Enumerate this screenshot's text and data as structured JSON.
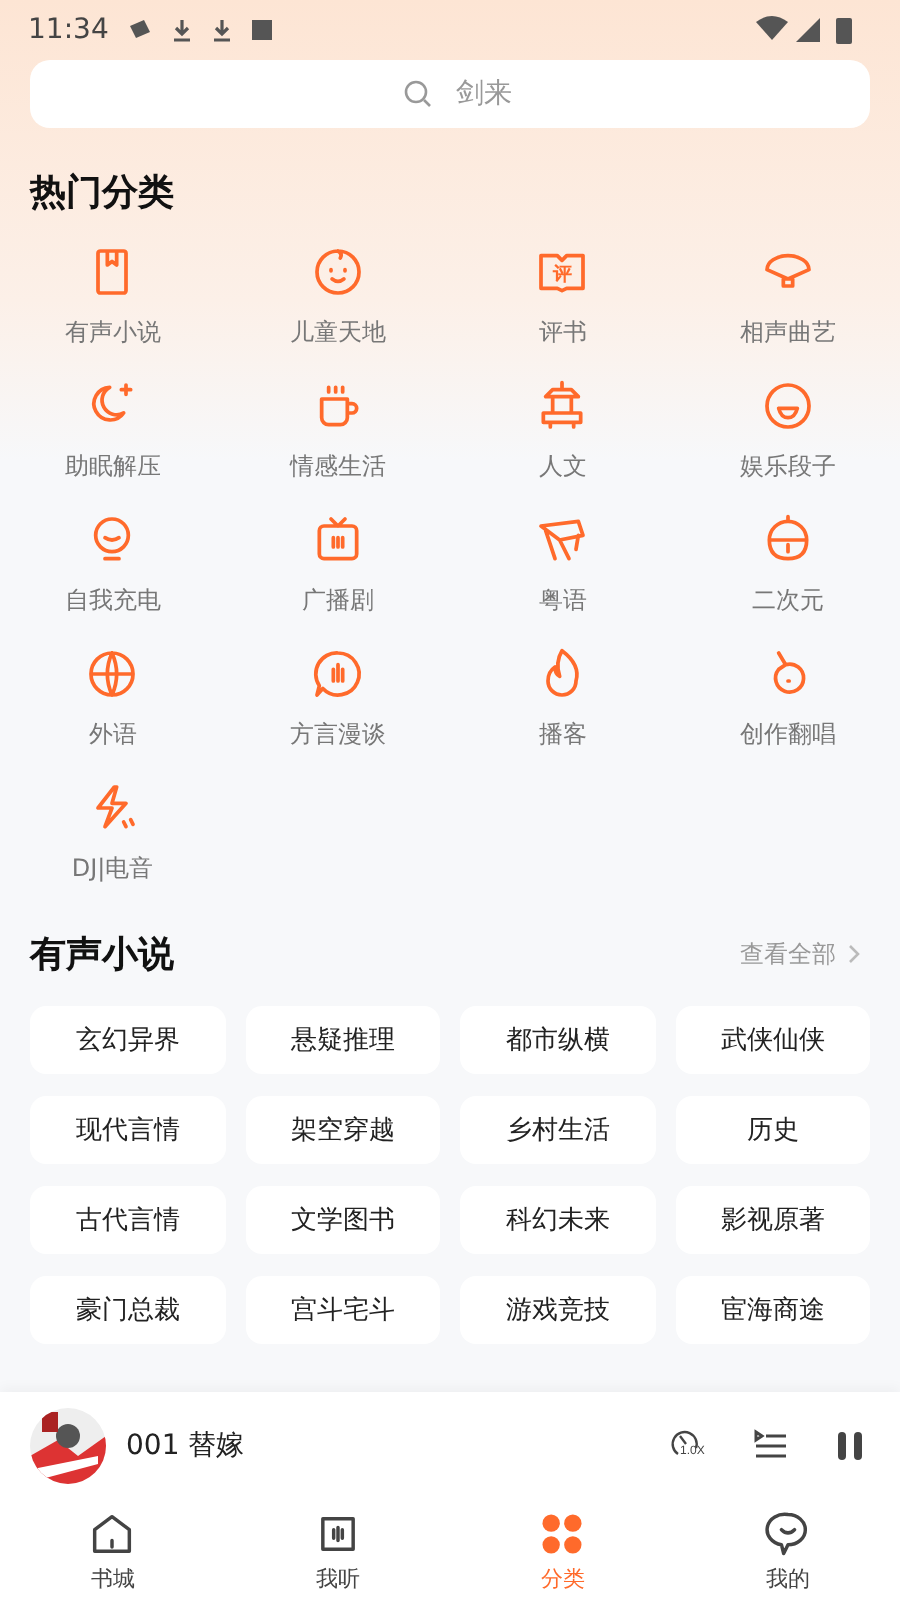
{
  "status_bar": {
    "time": "11:34"
  },
  "search": {
    "placeholder": "剑来"
  },
  "hot_categories": {
    "title": "热门分类",
    "items": [
      {
        "label": "有声小说"
      },
      {
        "label": "儿童天地"
      },
      {
        "label": "评书",
        "icon_text": "评"
      },
      {
        "label": "相声曲艺"
      },
      {
        "label": "助眠解压"
      },
      {
        "label": "情感生活"
      },
      {
        "label": "人文"
      },
      {
        "label": "娱乐段子"
      },
      {
        "label": "自我充电"
      },
      {
        "label": "广播剧"
      },
      {
        "label": "粤语"
      },
      {
        "label": "二次元"
      },
      {
        "label": "外语"
      },
      {
        "label": "方言漫谈"
      },
      {
        "label": "播客"
      },
      {
        "label": "创作翻唱"
      },
      {
        "label": "DJ|电音"
      }
    ]
  },
  "novel_section": {
    "title": "有声小说",
    "view_all": "查看全部",
    "tags": [
      "玄幻异界",
      "悬疑推理",
      "都市纵横",
      "武侠仙侠",
      "现代言情",
      "架空穿越",
      "乡村生活",
      "历史",
      "古代言情",
      "文学图书",
      "科幻未来",
      "影视原著",
      "豪门总裁",
      "宫斗宅斗",
      "游戏竞技",
      "宦海商途"
    ]
  },
  "player": {
    "title": "001 替嫁",
    "speed": "1.0X",
    "playing": true
  },
  "tabs": [
    {
      "label": "书城",
      "selected": false
    },
    {
      "label": "我听",
      "selected": false
    },
    {
      "label": "分类",
      "selected": true
    },
    {
      "label": "我的",
      "selected": false
    }
  ]
}
